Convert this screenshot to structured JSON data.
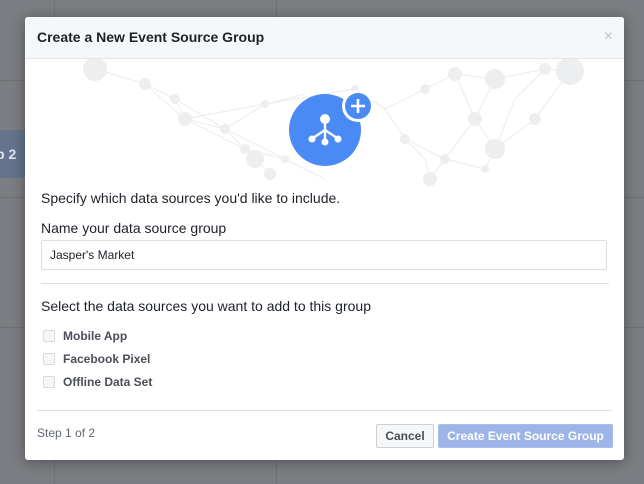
{
  "background": {
    "partial_tab_text": "p 2"
  },
  "dialog": {
    "title": "Create a New Event Source Group",
    "close_symbol": "×",
    "intro": "Specify which data sources you'd like to include.",
    "name_label": "Name your data source group",
    "name_value": "Jasper's Market",
    "sources_label": "Select the data sources you want to add to this group",
    "sources": [
      {
        "label": "Mobile App",
        "checked": false
      },
      {
        "label": "Facebook Pixel",
        "checked": false
      },
      {
        "label": "Offline Data Set",
        "checked": false
      }
    ],
    "step": "Step 1 of 2",
    "cancel_label": "Cancel",
    "create_label": "Create Event Source Group"
  },
  "colors": {
    "accent_blue": "#4267b2",
    "icon_blue": "#4a8af4",
    "disabled_button": "#9cb4e8"
  },
  "icons": [
    "close-icon",
    "event-source-group-icon",
    "plus-icon"
  ]
}
